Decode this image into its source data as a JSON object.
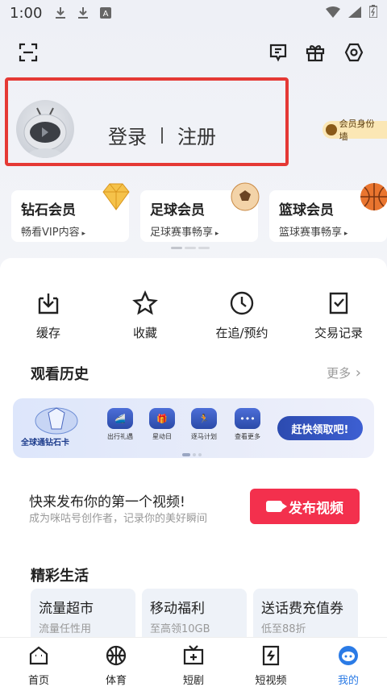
{
  "status_bar": {
    "time": "1:00",
    "icons": [
      "download-icon",
      "download-icon",
      "a-badge-icon",
      "wifi-icon",
      "signal-icon",
      "battery-icon"
    ]
  },
  "top_actions": {
    "icons": [
      "scan-icon",
      "message-icon",
      "gift-icon",
      "settings-icon"
    ]
  },
  "profile": {
    "login": "登录",
    "register": "注册",
    "badge_wall": "会员身份墙"
  },
  "memberships": [
    {
      "title": "钻石会员",
      "subtitle": "畅看VIP内容"
    },
    {
      "title": "足球会员",
      "subtitle": "足球赛事畅享"
    },
    {
      "title": "篮球会员",
      "subtitle": "篮球赛事畅享"
    }
  ],
  "quick_actions": [
    {
      "label": "缓存",
      "icon": "download-box-icon"
    },
    {
      "label": "收藏",
      "icon": "star-icon"
    },
    {
      "label": "在追/预约",
      "icon": "clock-icon"
    },
    {
      "label": "交易记录",
      "icon": "receipt-icon"
    }
  ],
  "history": {
    "title": "观看历史",
    "more": "更多"
  },
  "banner": {
    "brand": "全球通钻石卡",
    "items": [
      {
        "label": "出行礼遇"
      },
      {
        "label": "星动日"
      },
      {
        "label": "逐马计划"
      },
      {
        "label": "查看更多"
      }
    ],
    "cta": "赶快领取吧!"
  },
  "upload": {
    "title": "快来发布你的第一个视频!",
    "subtitle": "成为咪咕号创作者，记录你的美好瞬间",
    "button": "发布视频"
  },
  "life": {
    "title": "精彩生活",
    "cards": [
      {
        "title": "流量超市",
        "subtitle": "流量任性用"
      },
      {
        "title": "移动福利",
        "subtitle": "至高领10GB"
      },
      {
        "title": "送话费充值券",
        "subtitle": "低至88折"
      }
    ]
  },
  "tabbar": {
    "active_color": "#2b7be6",
    "tabs": [
      {
        "label": "首页"
      },
      {
        "label": "体育"
      },
      {
        "label": "短剧"
      },
      {
        "label": "短视频"
      },
      {
        "label": "我的"
      }
    ]
  }
}
